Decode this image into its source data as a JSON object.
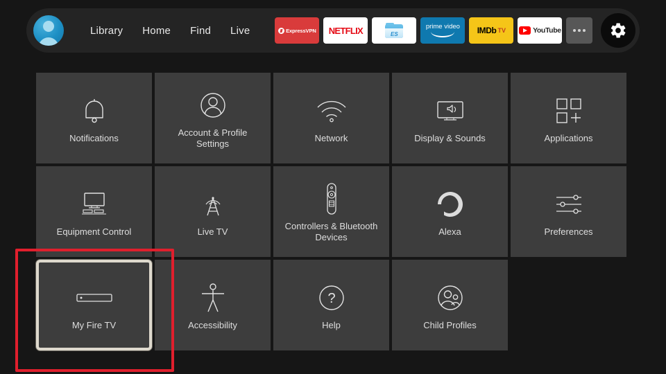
{
  "navbar": {
    "avatar_name": "profile-avatar",
    "links": [
      {
        "label": "Library"
      },
      {
        "label": "Home"
      },
      {
        "label": "Find"
      },
      {
        "label": "Live"
      }
    ],
    "apps": [
      {
        "name": "expressvpn",
        "label": "ExpressVPN",
        "color": "#d93b3b"
      },
      {
        "name": "netflix",
        "label": "NETFLIX",
        "color": "#ffffff"
      },
      {
        "name": "es-file-explorer",
        "label": "ES",
        "color": "#ffffff"
      },
      {
        "name": "prime-video",
        "label": "prime video",
        "color": "#0f79af"
      },
      {
        "name": "imdb-tv",
        "label": "IMDb",
        "sublabel": "TV",
        "color": "#f5c518"
      },
      {
        "name": "youtube",
        "label": "YouTube",
        "color": "#ffffff"
      }
    ],
    "more_label": "•••",
    "settings_label": "Settings"
  },
  "grid": {
    "rows": [
      [
        {
          "icon": "bell-icon",
          "label": "Notifications",
          "selected": false
        },
        {
          "icon": "person-circle-icon",
          "label": "Account & Profile Settings",
          "selected": false
        },
        {
          "icon": "wifi-icon",
          "label": "Network",
          "selected": false
        },
        {
          "icon": "tv-speaker-icon",
          "label": "Display & Sounds",
          "selected": false
        },
        {
          "icon": "apps-grid-icon",
          "label": "Applications",
          "selected": false
        }
      ],
      [
        {
          "icon": "equipment-icon",
          "label": "Equipment Control",
          "selected": false
        },
        {
          "icon": "antenna-icon",
          "label": "Live TV",
          "selected": false
        },
        {
          "icon": "remote-icon",
          "label": "Controllers & Bluetooth Devices",
          "selected": false
        },
        {
          "icon": "alexa-icon",
          "label": "Alexa",
          "selected": false
        },
        {
          "icon": "sliders-icon",
          "label": "Preferences",
          "selected": false
        }
      ],
      [
        {
          "icon": "firetv-stick-icon",
          "label": "My Fire TV",
          "selected": true
        },
        {
          "icon": "accessibility-icon",
          "label": "Accessibility",
          "selected": false
        },
        {
          "icon": "question-circle-icon",
          "label": "Help",
          "selected": false
        },
        {
          "icon": "child-profiles-icon",
          "label": "Child Profiles",
          "selected": false
        }
      ]
    ]
  },
  "annotation": {
    "name": "highlight-rectangle",
    "color": "#e01f2d",
    "targets": "My Fire TV"
  },
  "colors": {
    "background": "#161616",
    "navbar": "#242424",
    "tile": "#3d3d3d",
    "tile_label": "#dedede",
    "selected_border": "#ded9cd",
    "annotation_red": "#e01f2d"
  }
}
